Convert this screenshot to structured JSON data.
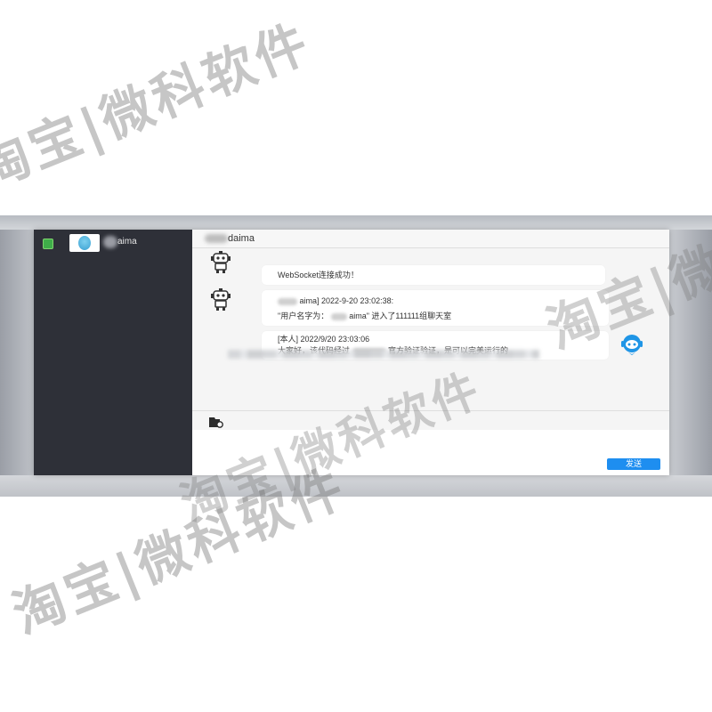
{
  "sidebar": {
    "contact_name": "aima"
  },
  "chat": {
    "header_title": "daima",
    "messages": [
      {
        "type": "system",
        "text": "WebSocket连接成功！"
      },
      {
        "type": "other",
        "line1": "aima] 2022-9-20 23:02:38:",
        "line2_prefix": "\"用户名字为：",
        "line2_suffix": "aima\" 进入了111111组聊天室"
      },
      {
        "type": "self",
        "line1": "[本人] 2022/9/20 23:03:06",
        "line2_prefix": "大家好，该代码经过",
        "line2_suffix": "官方验证验证，是可以完美运行的"
      }
    ]
  },
  "input": {
    "send_label": "发送"
  },
  "watermarks": [
    {
      "text": "淘宝|微科软件"
    },
    {
      "text": "淘宝|微科软件"
    },
    {
      "text": "淘宝|微科软件"
    },
    {
      "text": "淘宝|微科软件"
    }
  ],
  "colors": {
    "sidebar_bg": "#2e3038",
    "send_button": "#1e8ef0",
    "online_green": "#3fae49"
  }
}
